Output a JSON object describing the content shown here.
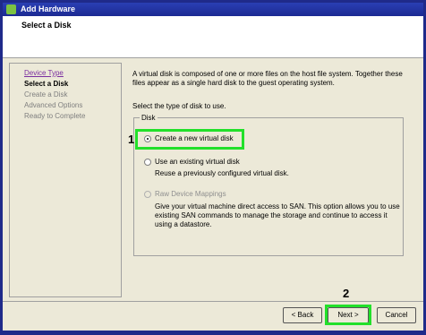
{
  "window": {
    "title": "Add Hardware"
  },
  "header": {
    "title": "Select a Disk"
  },
  "nav": {
    "items": [
      {
        "label": "Device Type",
        "state": "link"
      },
      {
        "label": "Select a Disk",
        "state": "current"
      },
      {
        "label": "Create a Disk",
        "state": "disabled"
      },
      {
        "label": "Advanced Options",
        "state": "disabled"
      },
      {
        "label": "Ready to Complete",
        "state": "disabled"
      }
    ]
  },
  "content": {
    "description": "A virtual disk is composed of one or more files on the host file system. Together these files appear as a single hard disk to the guest operating system.",
    "prompt": "Select the type of disk to use.",
    "group_label": "Disk",
    "options": [
      {
        "label": "Create a new virtual disk",
        "selected": true,
        "enabled": true,
        "detail": ""
      },
      {
        "label": "Use an existing virtual disk",
        "selected": false,
        "enabled": true,
        "detail": "Reuse a previously configured virtual disk."
      },
      {
        "label": "Raw Device Mappings",
        "selected": false,
        "enabled": false,
        "detail": "Give your virtual machine direct access to SAN. This option allows you to use existing SAN commands to manage the storage and continue to access it using a datastore."
      }
    ]
  },
  "annotations": {
    "step1": "1",
    "step2": "2"
  },
  "footer": {
    "back_label": "< Back",
    "next_label": "Next >",
    "cancel_label": "Cancel"
  },
  "colors": {
    "highlight": "#22e02a",
    "titlebar": "#1c2a93"
  }
}
